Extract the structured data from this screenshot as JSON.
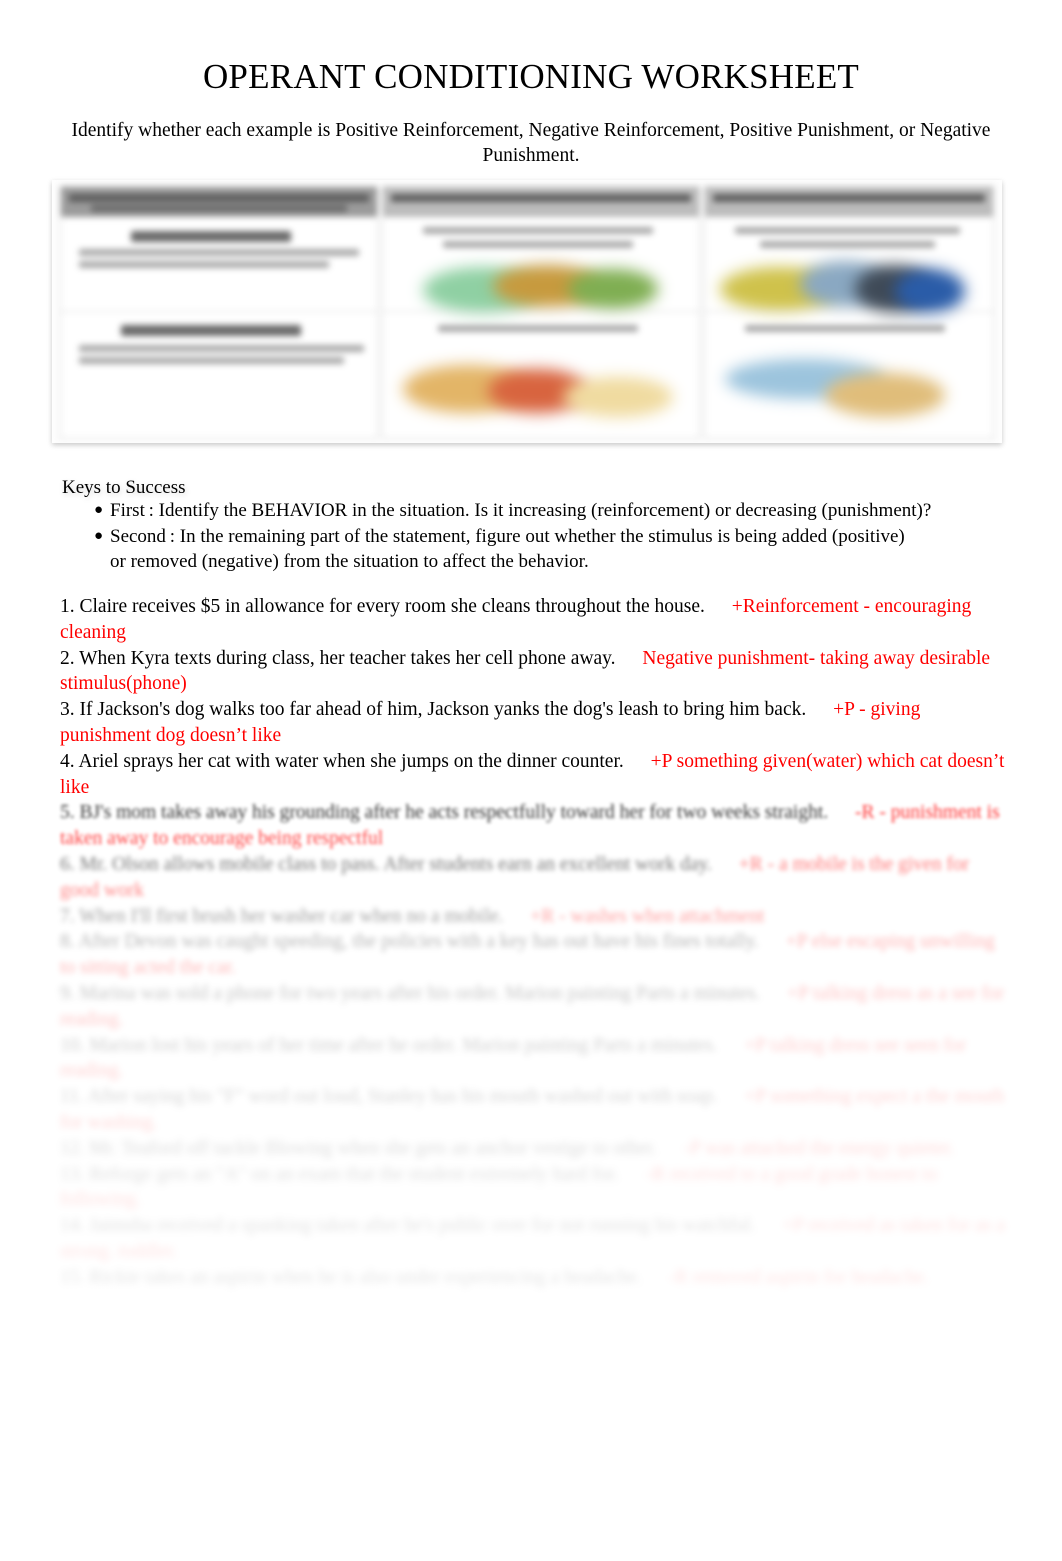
{
  "document": {
    "title": "OPERANT CONDITIONING WORKSHEET",
    "subtitle": "Identify whether each example is Positive Reinforcement, Negative Reinforcement, Positive Punishment, or Negative Punishment."
  },
  "diagram": {
    "caption": "operant-conditioning-quadrant-diagram",
    "note": "Embedded low-resolution three-column reference image; text is illegible.",
    "columns": 3
  },
  "keys": {
    "heading": "Keys to Success",
    "bullet_glyph": "●",
    "items": [
      {
        "line1": "First : Identify the BEHAVIOR in the situation. Is it increasing (reinforcement) or decreasing (punishment)?",
        "line2": ""
      },
      {
        "line1": "Second : In the remaining part of the statement, figure out whether the stimulus is being added (positive)",
        "line2": "or removed (negative) from the situation to affect the behavior."
      }
    ]
  },
  "answer_color": "#ff0000",
  "questions": [
    {
      "number": "1.",
      "prompt": "Claire receives $5 in allowance for every room she cleans throughout the house.",
      "answer": "+Reinforcement - encouraging cleaning",
      "blur": "b1"
    },
    {
      "number": "2.",
      "prompt": "When Kyra texts during class, her teacher takes her cell phone away.",
      "answer": "Negative punishment- taking away desirable stimulus(phone)",
      "blur": "b1"
    },
    {
      "number": "3.",
      "prompt": "If Jackson's dog walks too far ahead of him, Jackson yanks the dog's leash to bring him back.",
      "answer": "+P - giving punishment dog doesn’t like",
      "blur": "b1"
    },
    {
      "number": "4.",
      "prompt": "Ariel sprays her cat with water when she jumps on the dinner counter.",
      "answer": "+P something given(water) which cat doesn’t like",
      "blur": "b1"
    },
    {
      "number": "5.",
      "prompt": "BJ's mom takes away his grounding after he acts respectfully toward her for two weeks straight.",
      "answer": "-R - punishment is taken away to encourage being respectful",
      "blur": "b2"
    },
    {
      "number": "6.",
      "prompt": "Mr. Olson allows mobile class to pass. After students earn an excellent work day.",
      "answer": "+R - a mobile is the given for good work",
      "blur": "b3"
    },
    {
      "number": "7.",
      "prompt": "When I'll first brush her washer car when no a mobile.",
      "answer": "+R - washes when attachment",
      "blur": "b4"
    },
    {
      "number": "8.",
      "prompt": "After Devon was caught speeding, the policies with a key has out have his fines totally.",
      "answer": "+P else escaping unwilling to sitting acted the car.",
      "blur": "b5"
    },
    {
      "number": "9.",
      "prompt": "Marina was sold a phone for two years after his order. Marion painting Parts a minutes.",
      "answer": "+P talking dress as a see for reading.",
      "blur": "b6"
    },
    {
      "number": "10.",
      "prompt": "Marion lost his years of her time after he order. Marion painting Parts a minutes.",
      "answer": "+P talking dress see seen for reading.",
      "blur": "b7"
    },
    {
      "number": "11.",
      "prompt": "After saying his \"F\" word out loud, Stanley has his mouth washed out with soap.",
      "answer": "+P something expect a the mouth for washing.",
      "blur": "b8"
    },
    {
      "number": "12.",
      "prompt": "Mr. Teaford off tackle Blowing when she gets an anchor vestige to other.",
      "answer": "-P was attacked the energy quieter.",
      "blur": "b9"
    },
    {
      "number": "13.",
      "prompt": "Reforge gets an \"A\" on an exam that the student extremely hard for.",
      "answer": "-R received to a good grade honest to following.",
      "blur": "b10"
    },
    {
      "number": "14.",
      "prompt": "Jaimsha received a spanking taken after he's public over for not running his watchful.",
      "answer": "+P received as taken for as a strong. toddler.",
      "blur": "b11"
    },
    {
      "number": "15.",
      "prompt": "Rickie takes an aspirin when he is also under experiencing a headache.",
      "answer": "-R removed aspirin for headache.",
      "blur": "b12"
    }
  ]
}
